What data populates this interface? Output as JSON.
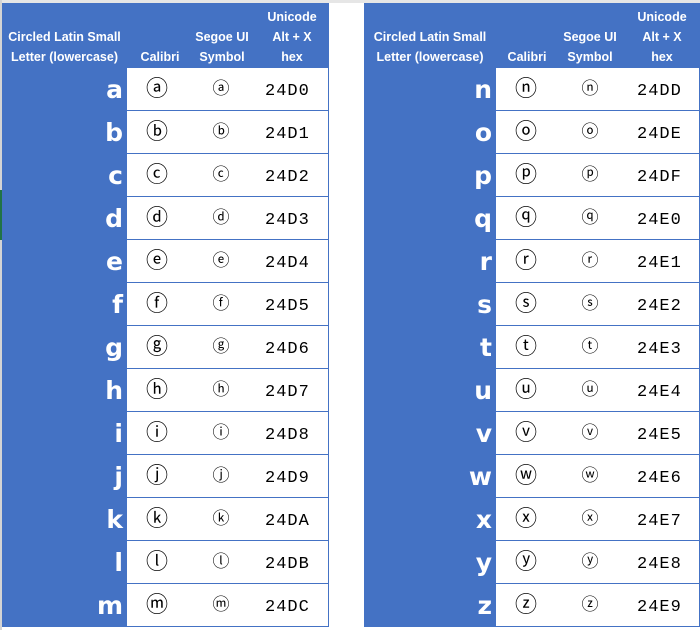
{
  "headers": {
    "letter": [
      "Circled Latin Small",
      "Letter (lowercase)"
    ],
    "calibri": "Calibri",
    "segoe": [
      "Segoe UI",
      "Symbol"
    ],
    "unicode": [
      "Unicode",
      "Alt + X",
      "hex"
    ]
  },
  "colors": {
    "header_bg": "#4472c4",
    "header_text": "#ffffff",
    "border": "#4472c4"
  },
  "left_rows": [
    {
      "letter": "a",
      "calibri": "ⓐ",
      "segoe": "ⓐ",
      "hex": "24D0"
    },
    {
      "letter": "b",
      "calibri": "ⓑ",
      "segoe": "ⓑ",
      "hex": "24D1"
    },
    {
      "letter": "c",
      "calibri": "ⓒ",
      "segoe": "ⓒ",
      "hex": "24D2"
    },
    {
      "letter": "d",
      "calibri": "ⓓ",
      "segoe": "ⓓ",
      "hex": "24D3"
    },
    {
      "letter": "e",
      "calibri": "ⓔ",
      "segoe": "ⓔ",
      "hex": "24D4"
    },
    {
      "letter": "f",
      "calibri": "ⓕ",
      "segoe": "ⓕ",
      "hex": "24D5"
    },
    {
      "letter": "g",
      "calibri": "ⓖ",
      "segoe": "ⓖ",
      "hex": "24D6"
    },
    {
      "letter": "h",
      "calibri": "ⓗ",
      "segoe": "ⓗ",
      "hex": "24D7"
    },
    {
      "letter": "i",
      "calibri": "ⓘ",
      "segoe": "ⓘ",
      "hex": "24D8"
    },
    {
      "letter": "j",
      "calibri": "ⓙ",
      "segoe": "ⓙ",
      "hex": "24D9"
    },
    {
      "letter": "k",
      "calibri": "ⓚ",
      "segoe": "ⓚ",
      "hex": "24DA"
    },
    {
      "letter": "l",
      "calibri": "ⓛ",
      "segoe": "ⓛ",
      "hex": "24DB"
    },
    {
      "letter": "m",
      "calibri": "ⓜ",
      "segoe": "ⓜ",
      "hex": "24DC"
    }
  ],
  "right_rows": [
    {
      "letter": "n",
      "calibri": "ⓝ",
      "segoe": "ⓝ",
      "hex": "24DD"
    },
    {
      "letter": "o",
      "calibri": "ⓞ",
      "segoe": "ⓞ",
      "hex": "24DE"
    },
    {
      "letter": "p",
      "calibri": "ⓟ",
      "segoe": "ⓟ",
      "hex": "24DF"
    },
    {
      "letter": "q",
      "calibri": "ⓠ",
      "segoe": "ⓠ",
      "hex": "24E0"
    },
    {
      "letter": "r",
      "calibri": "ⓡ",
      "segoe": "ⓡ",
      "hex": "24E1"
    },
    {
      "letter": "s",
      "calibri": "ⓢ",
      "segoe": "ⓢ",
      "hex": "24E2"
    },
    {
      "letter": "t",
      "calibri": "ⓣ",
      "segoe": "ⓣ",
      "hex": "24E3"
    },
    {
      "letter": "u",
      "calibri": "ⓤ",
      "segoe": "ⓤ",
      "hex": "24E4"
    },
    {
      "letter": "v",
      "calibri": "ⓥ",
      "segoe": "ⓥ",
      "hex": "24E5"
    },
    {
      "letter": "w",
      "calibri": "ⓦ",
      "segoe": "ⓦ",
      "hex": "24E6"
    },
    {
      "letter": "x",
      "calibri": "ⓧ",
      "segoe": "ⓧ",
      "hex": "24E7"
    },
    {
      "letter": "y",
      "calibri": "ⓨ",
      "segoe": "ⓨ",
      "hex": "24E8"
    },
    {
      "letter": "z",
      "calibri": "ⓩ",
      "segoe": "ⓩ",
      "hex": "24E9"
    }
  ]
}
